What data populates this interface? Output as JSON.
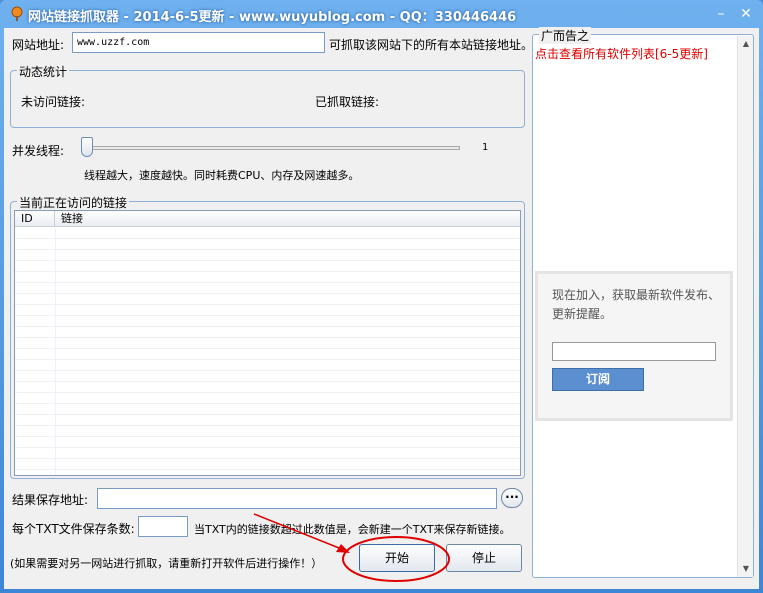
{
  "window": {
    "title": "网站链接抓取器 - 2014-6-5更新 - www.wuyublog.com - QQ：330446446",
    "minimize": "–",
    "close": "✕"
  },
  "url_row": {
    "label": "网站地址:",
    "value": "www.uzzf.com",
    "hint": "可抓取该网站下的所有本站链接地址。"
  },
  "stats": {
    "title": "动态统计",
    "unvisited_label": "未访问链接:",
    "fetched_label": "已抓取链接:"
  },
  "threads": {
    "label": "并发线程:",
    "value": "1",
    "level": 0,
    "hint": "线程越大，速度越快。同时耗费CPU、内存及网速越多。"
  },
  "current": {
    "title": "当前正在访问的链接",
    "columns": [
      "ID",
      "链接"
    ]
  },
  "save": {
    "label": "结果保存地址:",
    "value": "",
    "browse": "···"
  },
  "per_file": {
    "label": "每个TXT文件保存条数:",
    "value": "",
    "hint": "当TXT内的链接数超过此数值是，会新建一个TXT来保存新链接。"
  },
  "footer": {
    "note": "(如果需要对另一网站进行抓取，请重新打开软件后进行操作！）",
    "start": "开始",
    "stop": "停止"
  },
  "ad": {
    "title": "广而告之",
    "link": "点击查看所有软件列表[6-5更新]",
    "subscribe_text": "现在加入，获取最新软件发布、更新提醒。",
    "subscribe_value": "",
    "subscribe_button": "订阅"
  },
  "colors": {
    "title_bar": "#4a8fd8",
    "ad_link": "#e00000",
    "annotation": "#e00000",
    "subscribe_button": "#5b8fd0"
  }
}
